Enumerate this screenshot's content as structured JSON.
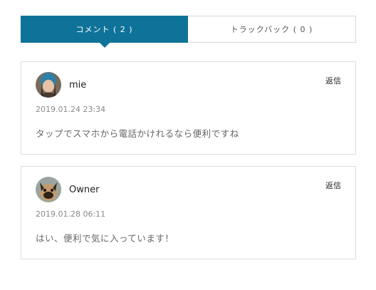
{
  "tabs": {
    "comments_label": "コメント ( 2 )",
    "trackbacks_label": "トラックバック ( 0 )"
  },
  "comments": [
    {
      "author": "mie",
      "date": "2019.01.24 23:34",
      "text": "タップでスマホから電話かけれるなら便利ですね",
      "reply_label": "返信"
    },
    {
      "author": "Owner",
      "date": "2019.01.28 06:11",
      "text": "はい、便利で気に入っています！",
      "reply_label": "返信"
    }
  ],
  "colors": {
    "accent": "#0f7399",
    "border": "#dcdcdc"
  }
}
